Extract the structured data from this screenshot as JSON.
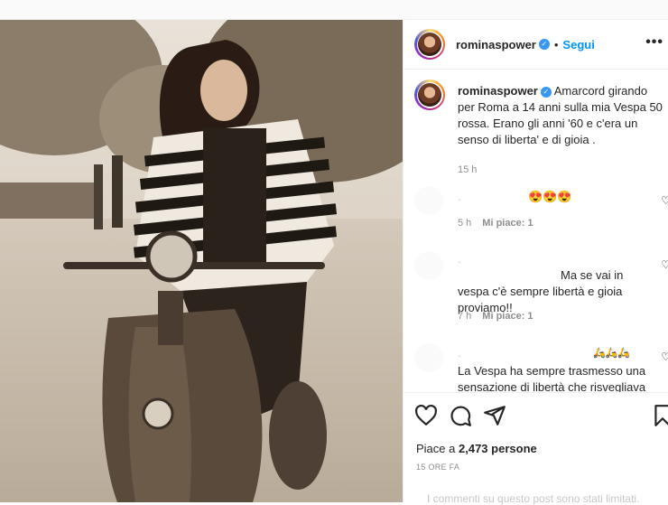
{
  "post": {
    "username": "rominaspower",
    "follow_label": "Segui",
    "more_label": "•••",
    "caption_text": "Amarcord girando per Roma a 14 anni sulla mia Vespa 50 rossa. Erano gli anni '60 e c'era un senso di liberta' e di gioia .",
    "caption_time": "15 h"
  },
  "comments": [
    {
      "text": "😍😍😍",
      "time": "5 h",
      "likes": "Mi piace: 1",
      "faded_name": "."
    },
    {
      "text": "Ma se vai in vespa c'è sempre libertà e gioia proviamo!!",
      "time": "7 h",
      "likes": "Mi piace: 1",
      "faded_name": "."
    },
    {
      "text": "La Vespa ha sempre trasmesso una sensazione di libertà che risvegliava",
      "emoji": "🛵🛵🛵",
      "faded_name": "."
    }
  ],
  "footer": {
    "likes_prefix": "Piace a",
    "likes_count": "2,473",
    "likes_suffix": "persone",
    "time_ago": "15 ORE FA",
    "limited_text": "I commenti su questo post sono stati limitati."
  },
  "icons": [
    "heart-icon",
    "comment-icon",
    "share-icon",
    "bookmark-icon",
    "verified-icon",
    "more-icon"
  ],
  "colors": {
    "accent": "#0095f6",
    "verified": "#3897f0",
    "muted": "#8e8e8e",
    "photo_tone": "#d9cfc2"
  }
}
